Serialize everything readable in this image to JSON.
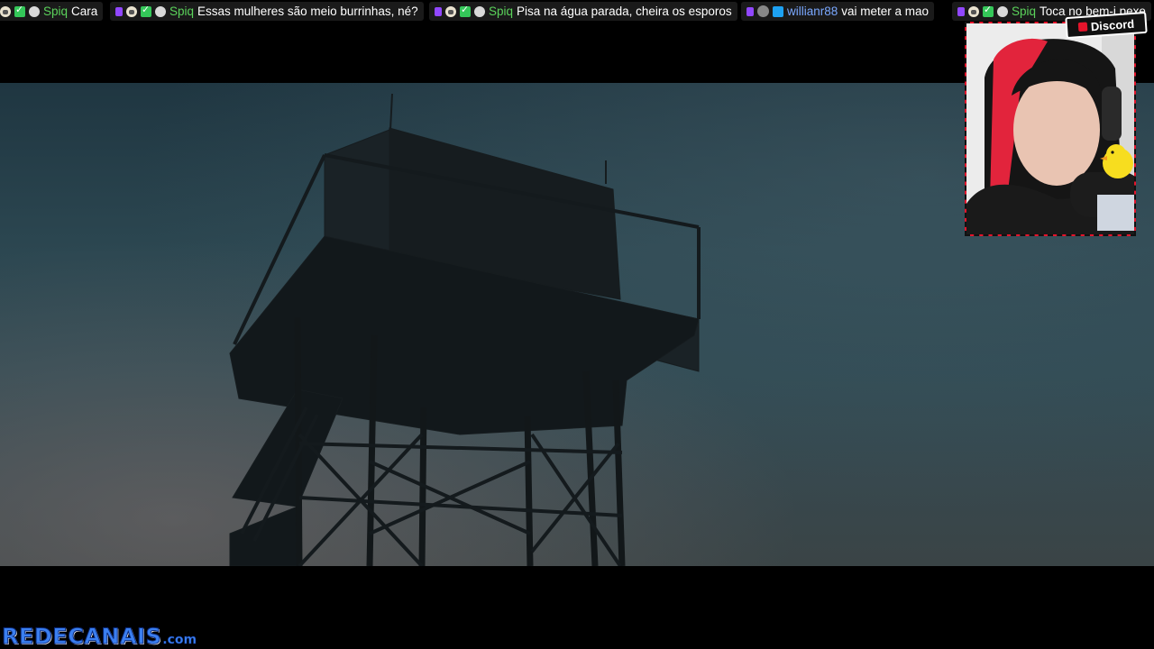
{
  "chat": {
    "messages": [
      {
        "badges": [
          "dog-badge",
          "check-badge",
          "cat-badge"
        ],
        "user": "Spiq",
        "user_color": "#5bd35b",
        "text": "Cara"
      },
      {
        "badges": [
          "sub-badge",
          "dog-badge",
          "check-badge",
          "cat-badge"
        ],
        "user": "Spiq",
        "user_color": "#5bd35b",
        "text": "Essas mulheres são meio burrinhas, né?"
      },
      {
        "badges": [
          "sub-badge",
          "dog-badge",
          "check-badge",
          "cat-badge"
        ],
        "user": "Spiq",
        "user_color": "#5bd35b",
        "text": "Pisa na água parada, cheira os esporos"
      },
      {
        "badges": [
          "sub-badge",
          "avatar-badge",
          "crown-badge"
        ],
        "user": "willianr88",
        "user_color": "#7aa8ff",
        "text": "vai meter a mao"
      },
      {
        "badges": [
          "sub-badge",
          "dog-badge",
          "check-badge",
          "cat-badge"
        ],
        "user": "Spiq",
        "user_color": "#5bd35b",
        "text": "Toca no bem-i pexe"
      }
    ]
  },
  "webcam": {
    "tag_label": "Discord",
    "border_color": "#e5142b"
  },
  "watermark": {
    "main": "REDECANAIS",
    "suffix": ".com"
  },
  "colors": {
    "background": "#000000",
    "sky": "#2c4751",
    "accent_red": "#e5142b"
  }
}
